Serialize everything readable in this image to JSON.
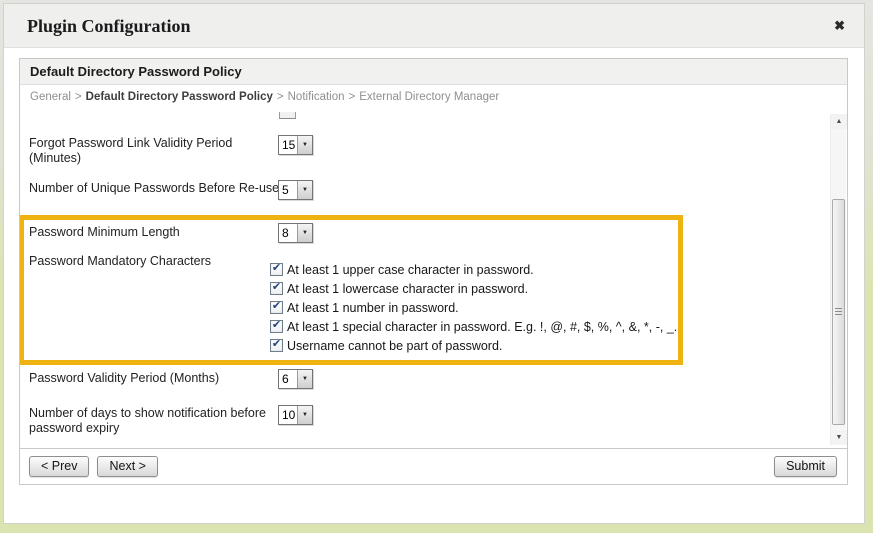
{
  "dialog": {
    "title": "Plugin Configuration"
  },
  "icons": {
    "close": "✖",
    "dropdown_arrow": "▼",
    "check": "✔",
    "scroll_up": "▲",
    "scroll_down": "▼"
  },
  "panel": {
    "title": "Default Directory Password Policy",
    "breadcrumb": {
      "separator": ">",
      "items": [
        {
          "label": "General"
        },
        {
          "label": "Default Directory Password Policy"
        },
        {
          "label": "Notification"
        },
        {
          "label": "External Directory Manager"
        }
      ]
    }
  },
  "form": {
    "rows": [
      {
        "label": "Forgot Password Link Validity Period (Minutes)",
        "value": "15"
      },
      {
        "label": "Number of Unique Passwords Before Re-use",
        "value": "5"
      },
      {
        "label": "Password Minimum Length",
        "value": "8"
      },
      {
        "label": "Password Mandatory Characters",
        "options": [
          {
            "label": "At least 1 upper case character in password.",
            "checked": true
          },
          {
            "label": "At least 1 lowercase character in password.",
            "checked": true
          },
          {
            "label": "At least 1 number in password.",
            "checked": true
          },
          {
            "label": "At least 1 special character in password. E.g. !, @, #, $, %, ^, &, *, -, _.",
            "checked": true
          },
          {
            "label": "Username cannot be part of password.",
            "checked": true
          }
        ]
      },
      {
        "label": "Password Validity Period (Months)",
        "value": "6"
      },
      {
        "label": "Number of days to show notification before password expiry",
        "value": "10"
      }
    ]
  },
  "buttons": {
    "prev": "< Prev",
    "next": "Next >",
    "submit": "Submit"
  },
  "colors": {
    "highlight": "#eeb211",
    "page_background": "#d9e4b0"
  }
}
